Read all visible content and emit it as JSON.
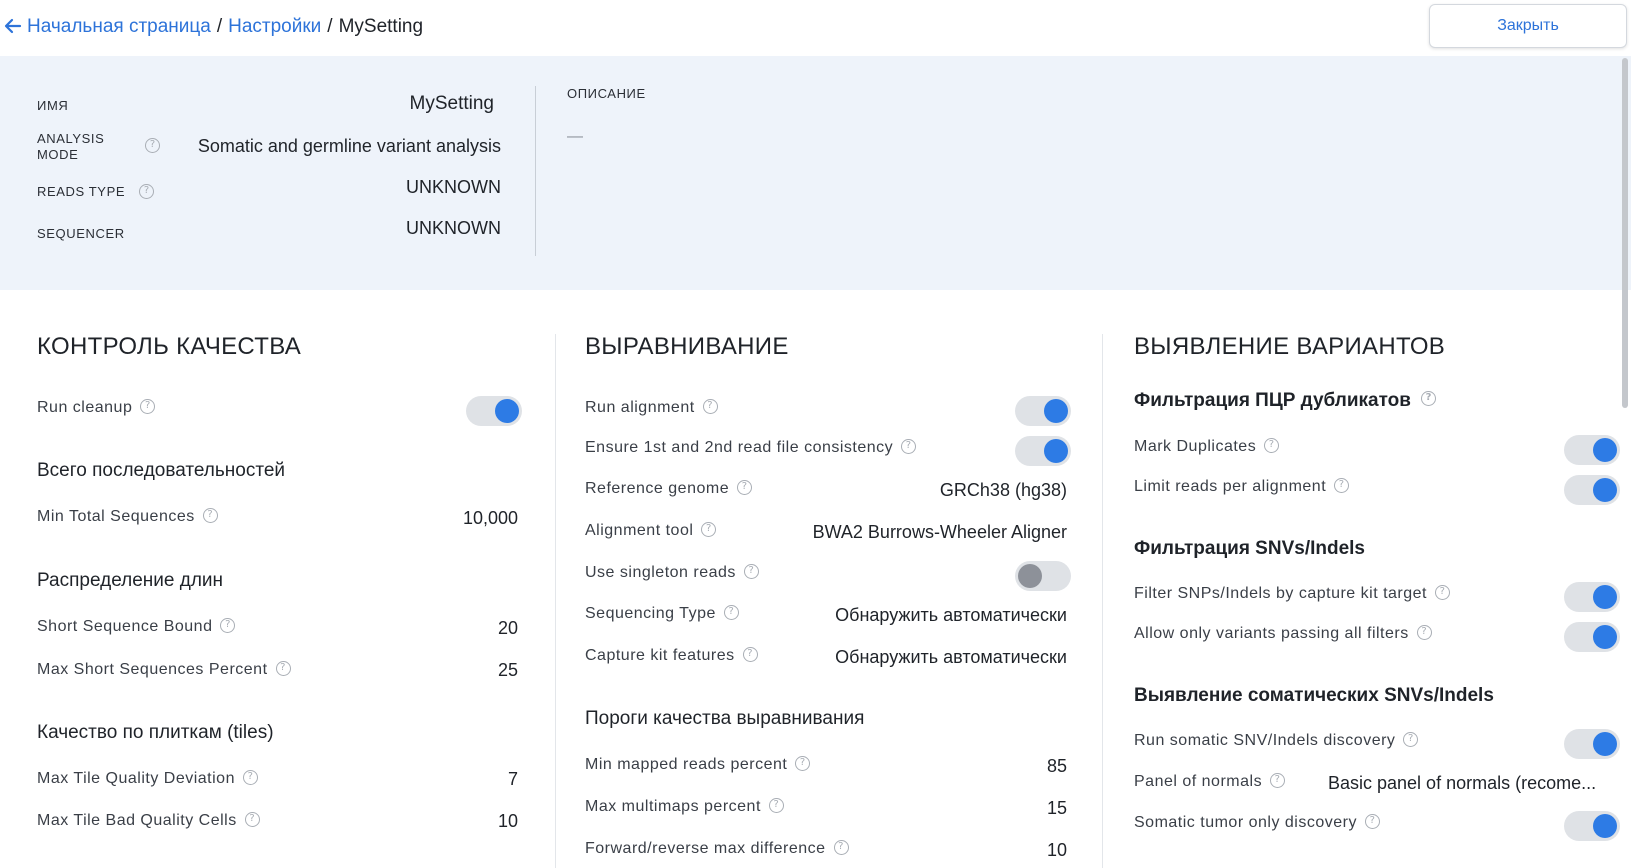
{
  "breadcrumb": {
    "home": "Начальная страница",
    "settings": "Настройки",
    "current": "MySetting",
    "sep": "/"
  },
  "close_button": "Закрыть",
  "info": {
    "name_label": "ИМЯ",
    "name_value": "MySetting",
    "mode_label_1": "ANALYSIS",
    "mode_label_2": "MODE",
    "mode_value": "Somatic and germline variant analysis",
    "reads_label": "READS TYPE",
    "reads_value": "UNKNOWN",
    "sequencer_label": "SEQUENCER",
    "sequencer_value": "UNKNOWN",
    "description_label": "ОПИСАНИЕ",
    "description_value": "—"
  },
  "qc": {
    "title": "КОНТРОЛЬ КАЧЕСТВА",
    "run_cleanup": "Run cleanup",
    "total_title": "Всего последовательностей",
    "min_total_label": "Min Total Sequences",
    "min_total_value": "10,000",
    "length_title": "Распределение длин",
    "short_bound_label": "Short Sequence Bound",
    "short_bound_value": "20",
    "max_short_label": "Max Short Sequences Percent",
    "max_short_value": "25",
    "tiles_title": "Качество по плиткам (tiles)",
    "tile_dev_label": "Max Tile Quality Deviation",
    "tile_dev_value": "7",
    "tile_bad_label": "Max Tile Bad Quality Cells",
    "tile_bad_value": "10"
  },
  "alignment": {
    "title": "ВЫРАВНИВАНИЕ",
    "run_alignment": "Run alignment",
    "ensure_consistency": "Ensure 1st and 2nd read file consistency",
    "ref_genome_label": "Reference genome",
    "ref_genome_value": "GRCh38 (hg38)",
    "tool_label": "Alignment tool",
    "tool_value": "BWA2 Burrows-Wheeler Aligner",
    "singleton_label": "Use singleton reads",
    "seq_type_label": "Sequencing Type",
    "seq_type_value": "Обнаружить автоматически",
    "capture_label": "Capture kit features",
    "capture_value": "Обнаружить автоматически",
    "thresholds_title": "Пороги качества выравнивания",
    "mapped_label": "Min mapped reads percent",
    "mapped_value": "85",
    "multimaps_label": "Max multimaps percent",
    "multimaps_value": "15",
    "fr_label": "Forward/reverse max difference",
    "fr_value": "10"
  },
  "variants": {
    "title": "ВЫЯВЛЕНИЕ ВАРИАНТОВ",
    "pcr_title": "Фильтрация ПЦР дубликатов",
    "mark_dup": "Mark Duplicates",
    "limit_reads": "Limit reads per alignment",
    "snv_title": "Фильтрация SNVs/Indels",
    "filter_capture": "Filter SNPs/Indels by capture kit target",
    "allow_passing": "Allow only variants passing all filters",
    "somatic_title": "Выявление соматических SNVs/Indels",
    "run_somatic": "Run somatic SNV/Indels discovery",
    "panel_label": "Panel of normals",
    "panel_value": "Basic panel of normals (recome...",
    "tumor_only": "Somatic tumor only discovery"
  },
  "toggles": {
    "run_cleanup": true,
    "run_alignment": true,
    "ensure_consistency": true,
    "use_singleton": false,
    "mark_dup": true,
    "limit_reads": true,
    "filter_capture": true,
    "allow_passing": true,
    "run_somatic": true,
    "tumor_only": true
  },
  "help_glyph": "?",
  "colors": {
    "accent": "#2d7be5",
    "link": "#2d73d9",
    "panel_bg": "#eef3fa"
  }
}
